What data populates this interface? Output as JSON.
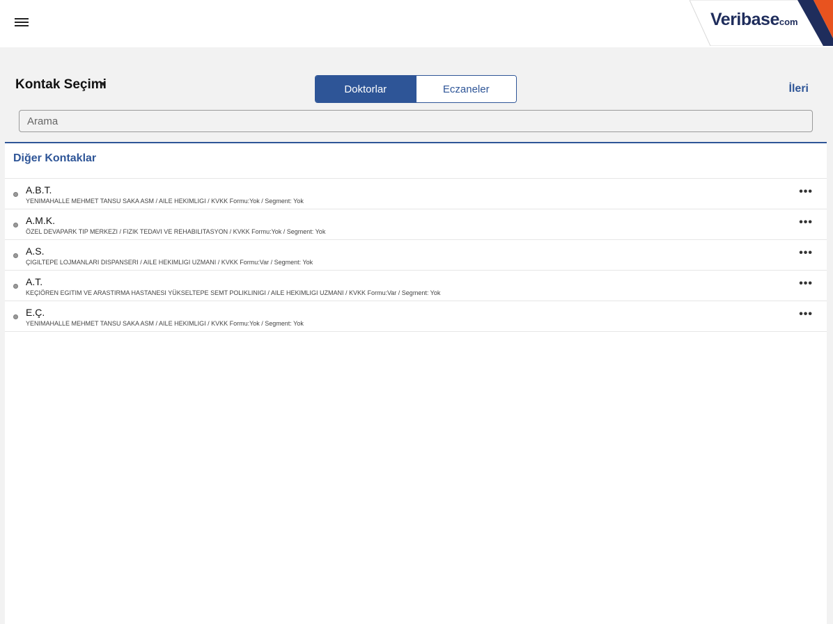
{
  "header": {
    "menu_icon": "hamburger-menu-icon",
    "logo": {
      "brand": "Veribase",
      "suffix": "com"
    }
  },
  "page": {
    "title": "Kontak Seçimi",
    "title_caret": "▼",
    "next_label": "İleri"
  },
  "tabs": [
    {
      "label": "Doktorlar",
      "active": true
    },
    {
      "label": "Eczaneler",
      "active": false
    }
  ],
  "search": {
    "placeholder": "Arama",
    "value": ""
  },
  "section": {
    "title": "Diğer Kontaklar"
  },
  "contacts": [
    {
      "name": "A.B.T.",
      "detail": "YENIMAHALLE MEHMET TANSU SAKA ASM / AILE HEKIMLIGI / KVKK Formu:Yok / Segment: Yok",
      "more": "•••"
    },
    {
      "name": "A.M.K.",
      "detail": "ÖZEL DEVAPARK TIP MERKEZI / FIZIK TEDAVI VE REHABILITASYON / KVKK Formu:Yok / Segment: Yok",
      "more": "•••"
    },
    {
      "name": "A.S.",
      "detail": "ÇIGILTEPE LOJMANLARI DISPANSERI / AILE HEKIMLIGI UZMANI / KVKK Formu:Var / Segment: Yok",
      "more": "•••"
    },
    {
      "name": "A.T.",
      "detail": "KEÇIÖREN EGITIM VE ARASTIRMA HASTANESI YÜKSELTEPE SEMT POLIKLINIGI / AILE HEKIMLIGI UZMANI / KVKK Formu:Var / Segment: Yok",
      "more": "•••"
    },
    {
      "name": "E.Ç.",
      "detail": "YENIMAHALLE MEHMET TANSU SAKA ASM / AILE HEKIMLIGI / KVKK Formu:Yok / Segment: Yok",
      "more": "•••"
    }
  ],
  "colors": {
    "accent": "#2e5597",
    "logo_navy": "#1f2d5c",
    "logo_orange": "#e8531f",
    "background": "#f2f2f2"
  }
}
